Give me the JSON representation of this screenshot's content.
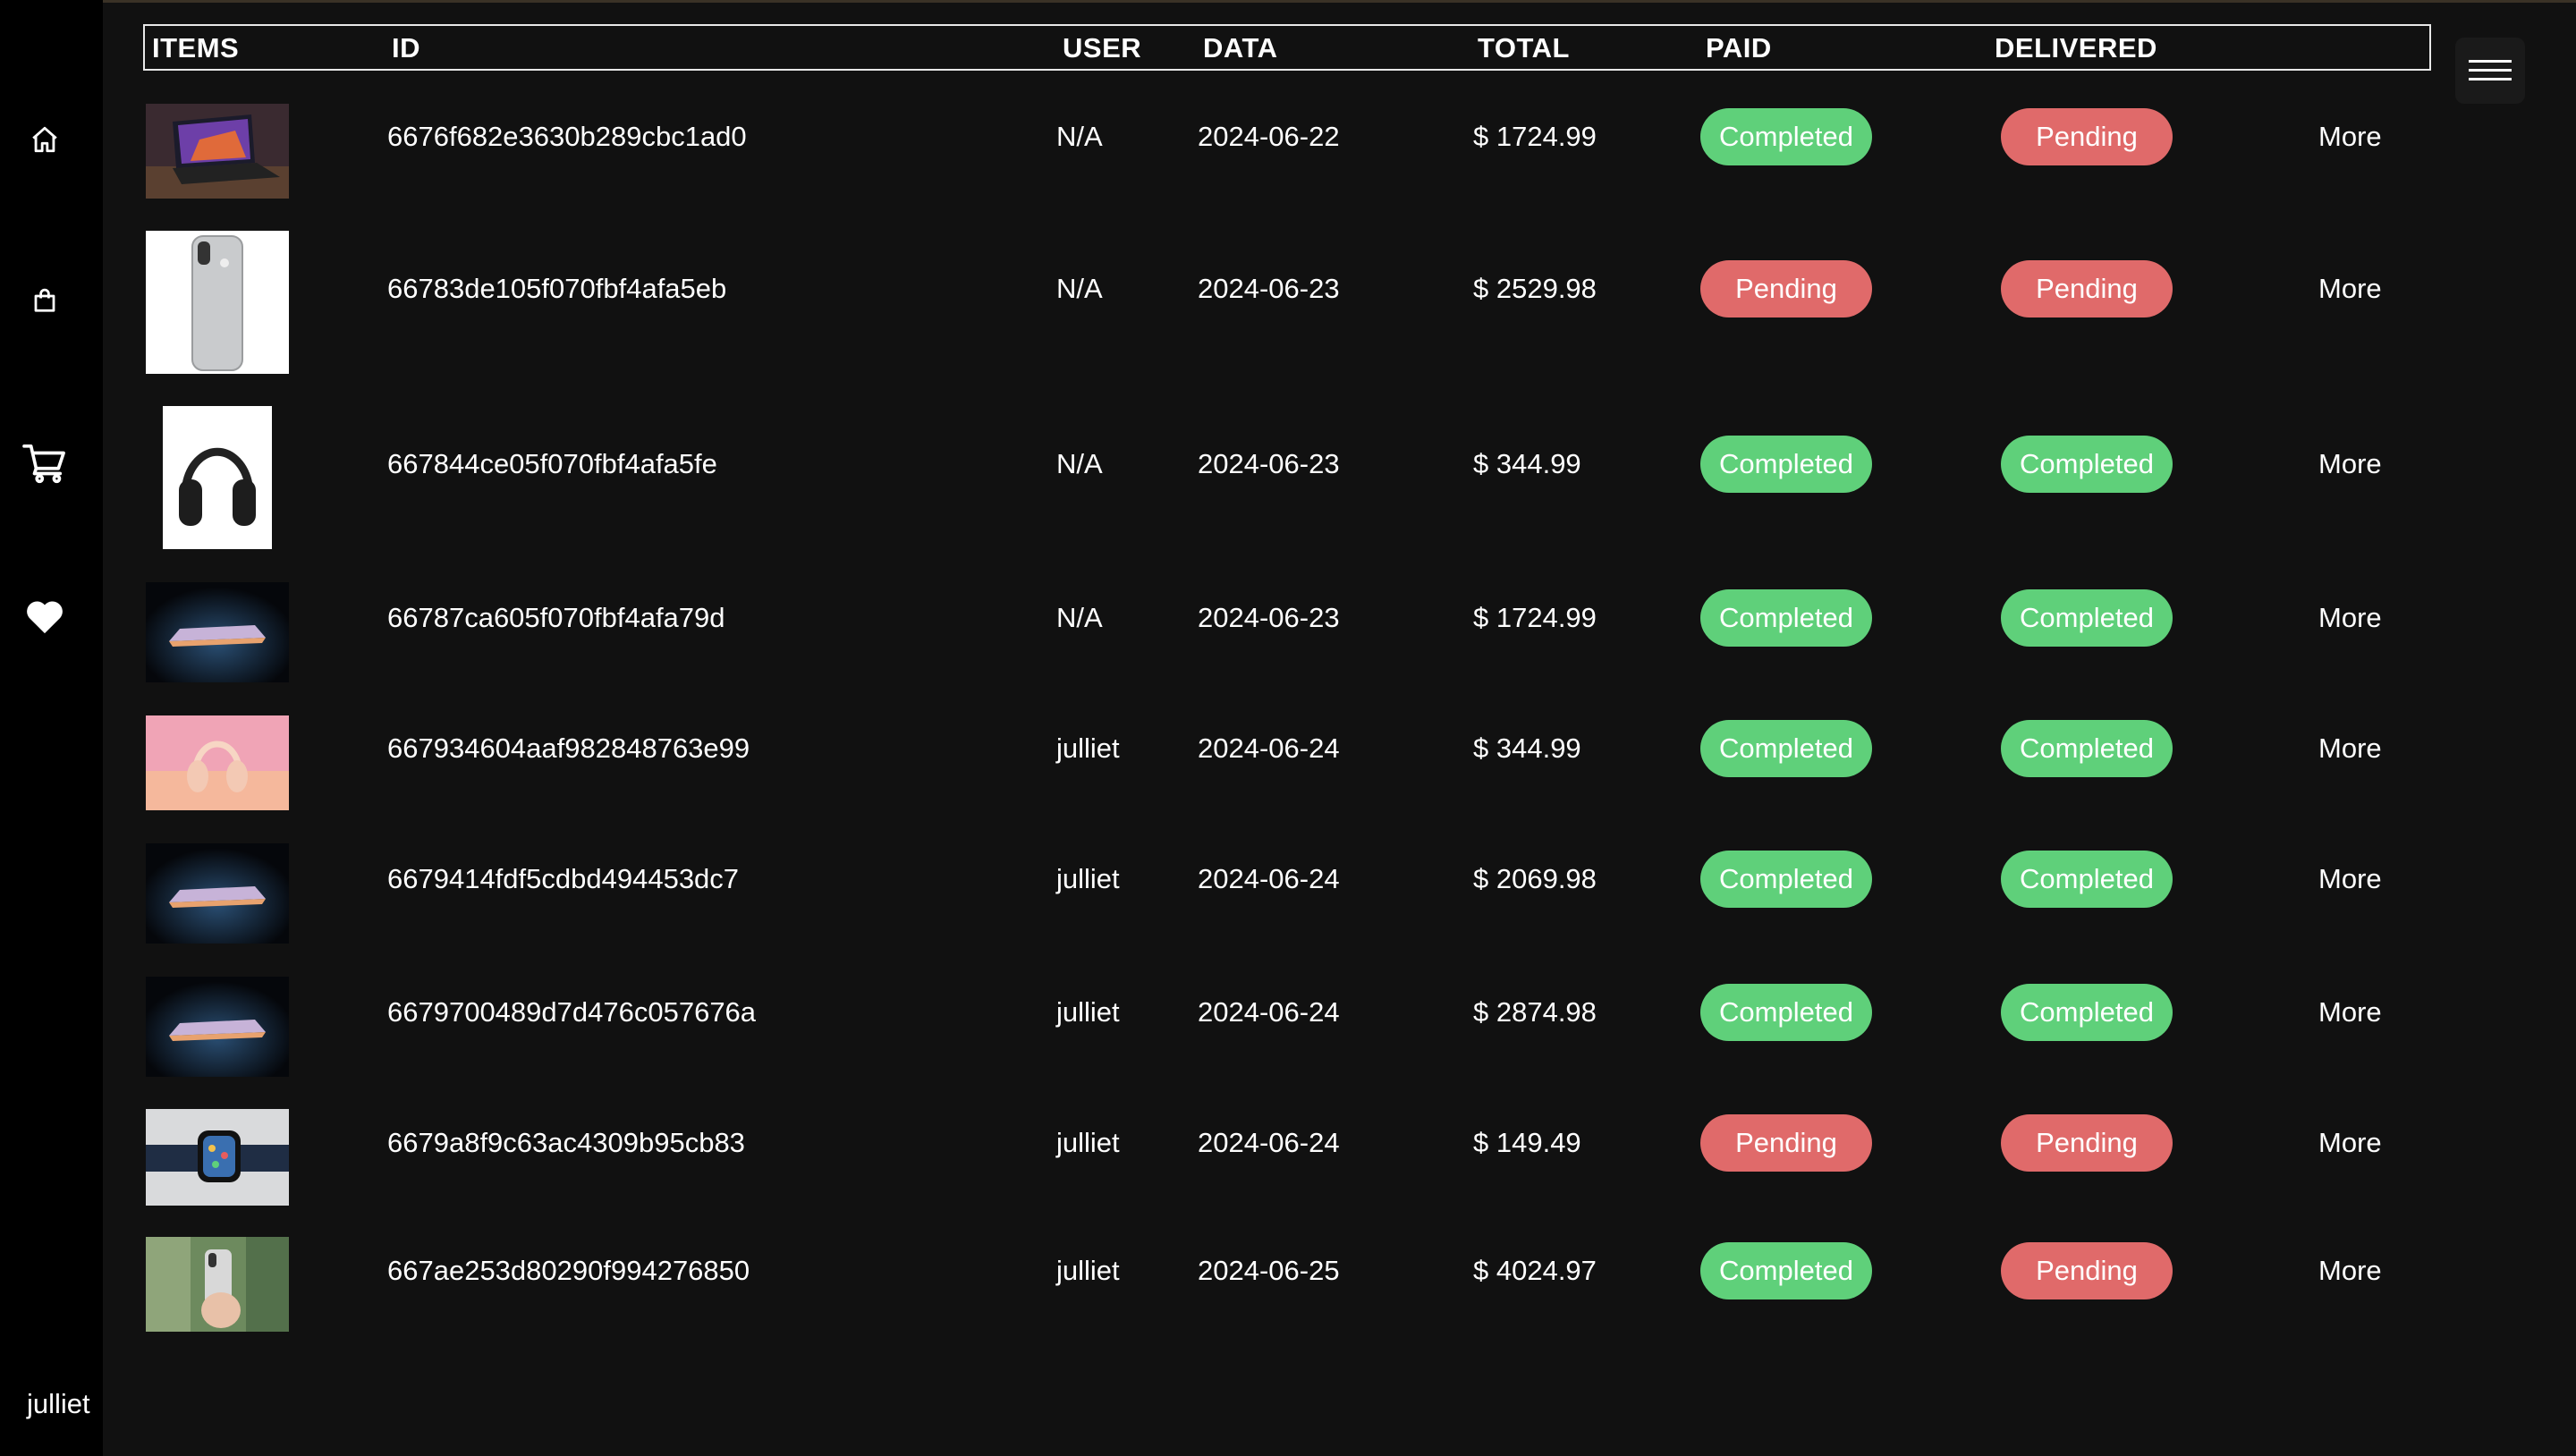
{
  "sidebar": {
    "icons": [
      "home-icon",
      "shopping-bag-icon",
      "cart-icon",
      "heart-icon"
    ],
    "username": "julliet"
  },
  "table": {
    "headers": [
      "ITEMS",
      "ID",
      "USER",
      "DATA",
      "TOTAL",
      "PAID",
      "DELIVERED"
    ],
    "more_label": "More",
    "rows": [
      {
        "thumb": "laptop-photo",
        "id": "6676f682e3630b289cbc1ad0",
        "user": "N/A",
        "date": "2024-06-22",
        "total": "$ 1724.99",
        "paid": "Completed",
        "delivered": "Pending"
      },
      {
        "thumb": "iphone-photo",
        "id": "66783de105f070fbf4afa5eb",
        "user": "N/A",
        "date": "2024-06-23",
        "total": "$ 2529.98",
        "paid": "Pending",
        "delivered": "Pending"
      },
      {
        "thumb": "headphones-photo",
        "id": "667844ce05f070fbf4afa5fe",
        "user": "N/A",
        "date": "2024-06-23",
        "total": "$ 344.99",
        "paid": "Completed",
        "delivered": "Completed"
      },
      {
        "thumb": "macbook-dark-photo",
        "id": "66787ca605f070fbf4afa79d",
        "user": "N/A",
        "date": "2024-06-23",
        "total": "$ 1724.99",
        "paid": "Completed",
        "delivered": "Completed"
      },
      {
        "thumb": "pink-headphones-photo",
        "id": "667934604aaf982848763e99",
        "user": "julliet",
        "date": "2024-06-24",
        "total": "$ 344.99",
        "paid": "Completed",
        "delivered": "Completed"
      },
      {
        "thumb": "macbook-dark-photo",
        "id": "6679414fdf5cdbd494453dc7",
        "user": "julliet",
        "date": "2024-06-24",
        "total": "$ 2069.98",
        "paid": "Completed",
        "delivered": "Completed"
      },
      {
        "thumb": "macbook-dark-photo",
        "id": "6679700489d7d476c057676a",
        "user": "julliet",
        "date": "2024-06-24",
        "total": "$ 2874.98",
        "paid": "Completed",
        "delivered": "Completed"
      },
      {
        "thumb": "watch-photo",
        "id": "6679a8f9c63ac4309b95cb83",
        "user": "julliet",
        "date": "2024-06-24",
        "total": "$ 149.49",
        "paid": "Pending",
        "delivered": "Pending"
      },
      {
        "thumb": "iphone-hand-photo",
        "id": "667ae253d80290f994276850",
        "user": "julliet",
        "date": "2024-06-25",
        "total": "$ 4024.97",
        "paid": "Completed",
        "delivered": "Pending"
      }
    ]
  },
  "colors": {
    "completed": "#5fd07a",
    "pending": "#e06a6a",
    "background": "#111111",
    "sidebar": "#000000"
  },
  "menu": {
    "icon": "hamburger-icon"
  }
}
